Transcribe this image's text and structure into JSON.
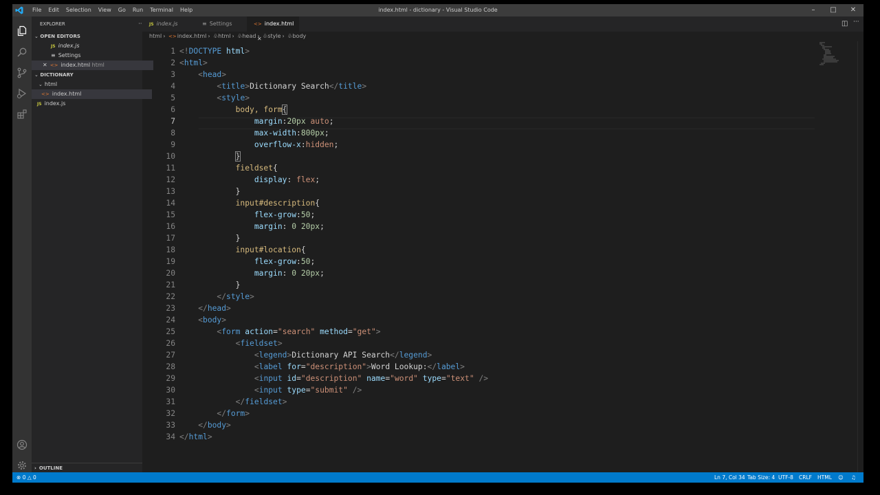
{
  "window": {
    "title": "index.html - dictionary - Visual Studio Code",
    "menu": [
      "File",
      "Edit",
      "Selection",
      "View",
      "Go",
      "Run",
      "Terminal",
      "Help"
    ]
  },
  "sidebar": {
    "header": "EXPLORER",
    "open_editors_label": "OPEN EDITORS",
    "open_editors": [
      {
        "name": "index.js",
        "type": "js"
      },
      {
        "name": "Settings",
        "type": "settings"
      },
      {
        "name": "index.html",
        "suffix": "html",
        "type": "html"
      }
    ],
    "project_label": "DICTIONARY",
    "tree": [
      {
        "name": "html",
        "type": "folder"
      },
      {
        "name": "index.html",
        "type": "html"
      },
      {
        "name": "index.js",
        "type": "js"
      }
    ],
    "outline_label": "OUTLINE"
  },
  "tabs": [
    {
      "label": "index.js",
      "active": false
    },
    {
      "label": "Settings",
      "active": false
    },
    {
      "label": "index.html",
      "active": true
    }
  ],
  "breadcrumb": [
    "html",
    "index.html",
    "html",
    "head",
    "style",
    "body"
  ],
  "editor": {
    "current_line": 7,
    "line_numbers": [
      "1",
      "2",
      "3",
      "4",
      "5",
      "6",
      "7",
      "8",
      "9",
      "10",
      "11",
      "12",
      "13",
      "14",
      "15",
      "16",
      "17",
      "18",
      "19",
      "20",
      "21",
      "22",
      "23",
      "24",
      "25",
      "26",
      "27",
      "28",
      "29",
      "30",
      "31",
      "32",
      "33",
      "34"
    ]
  },
  "status": {
    "errors": "0",
    "warnings": "0",
    "cursor": "Ln 7, Col 34",
    "tab_size": "Tab Size: 4",
    "encoding": "UTF-8",
    "eol": "CRLF",
    "language": "HTML"
  },
  "colors": {
    "status_bar": "#007acc",
    "editor_bg": "#1e1e1e",
    "sidebar_bg": "#252526"
  }
}
